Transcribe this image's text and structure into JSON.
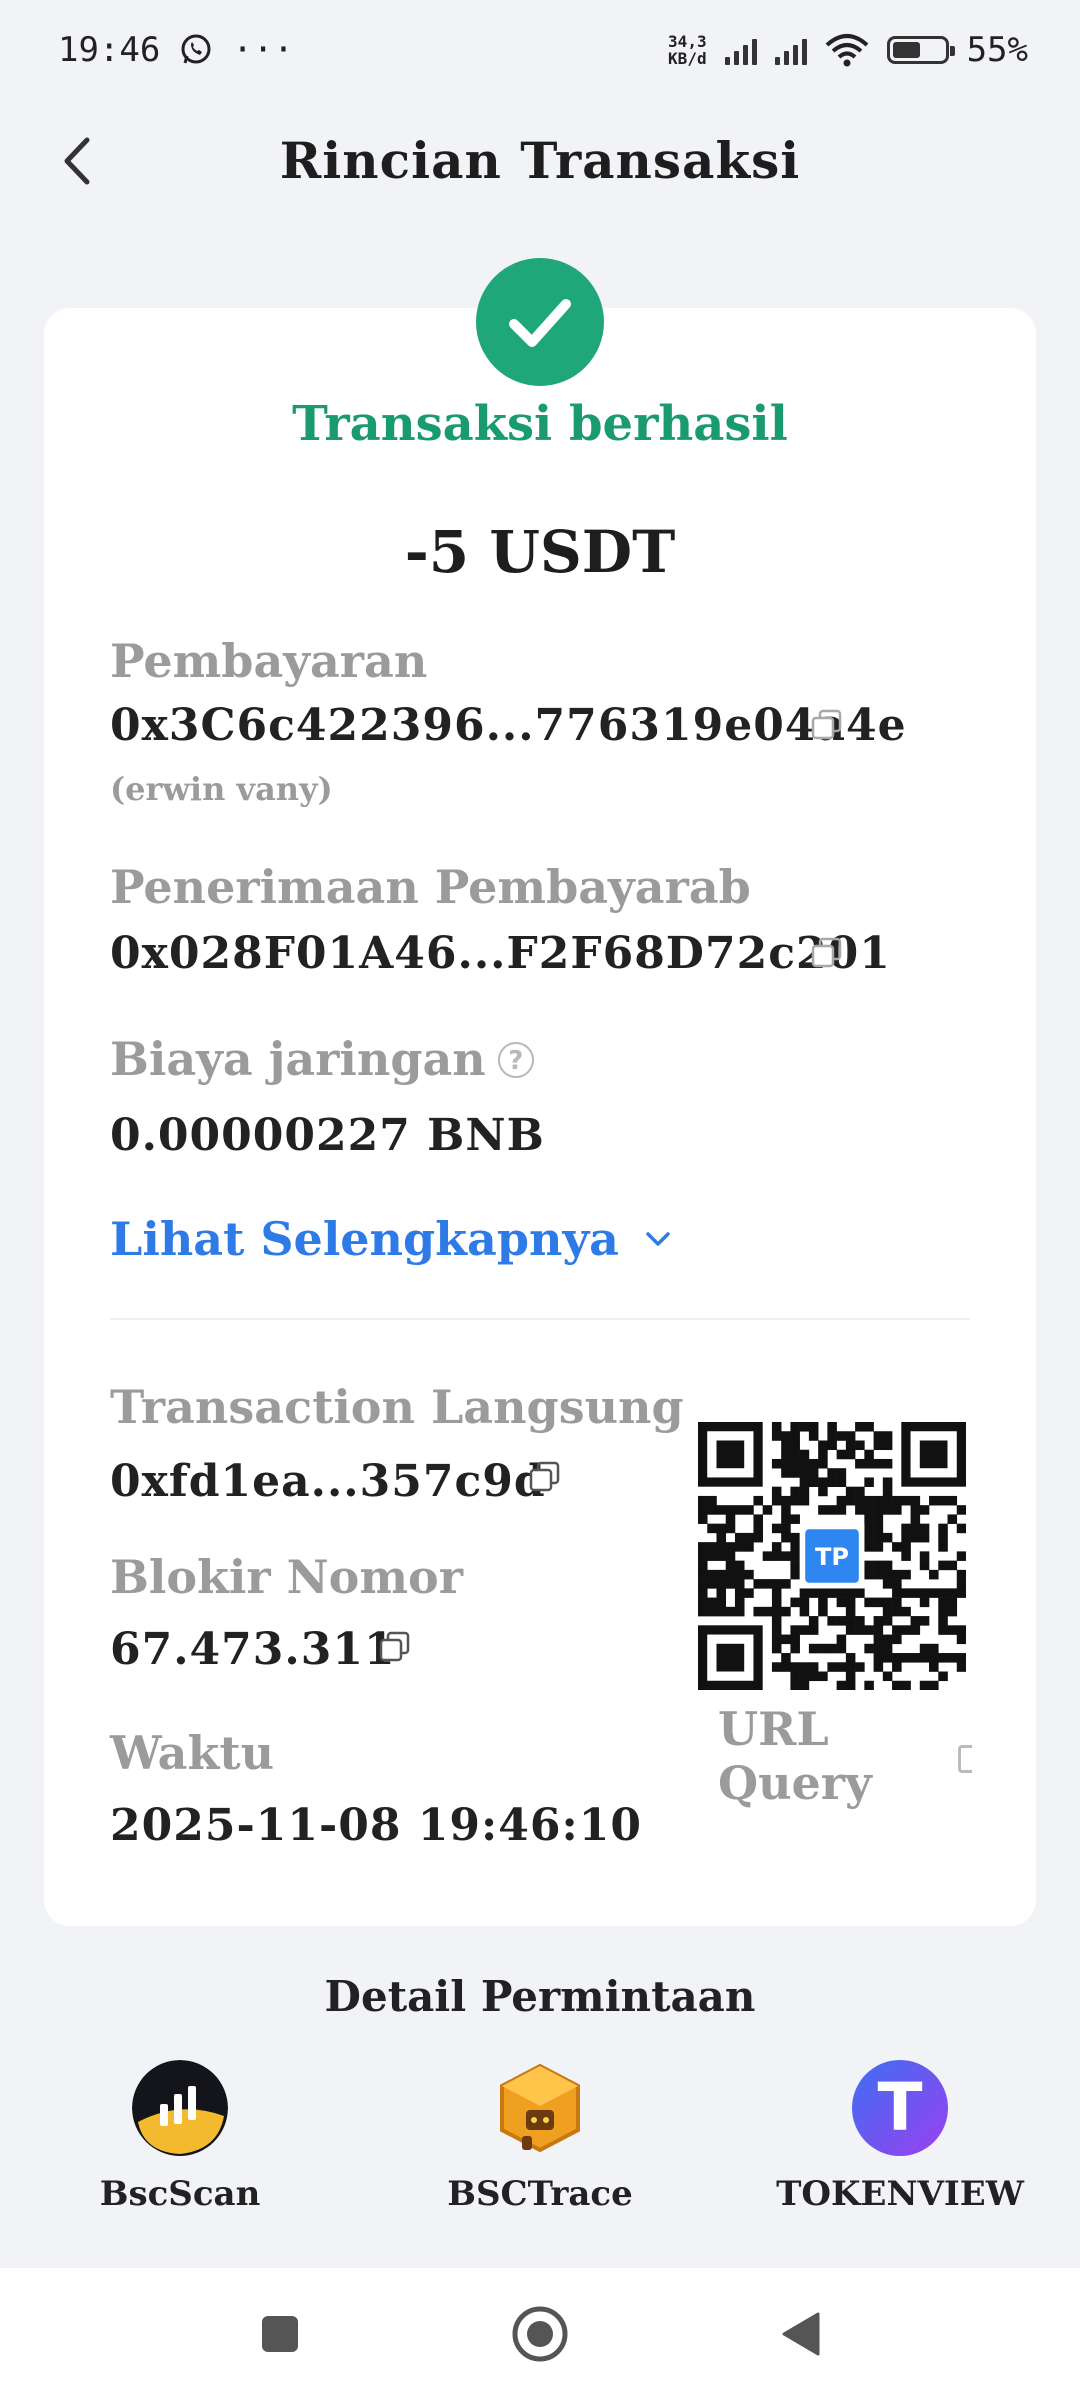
{
  "status_bar": {
    "time": "19:46",
    "more": "···",
    "net_speed_value": "34,3",
    "net_speed_unit": "KB/d",
    "battery_level": 55,
    "battery_text": "55%"
  },
  "header": {
    "title": "Rincian Transaksi"
  },
  "transaction": {
    "status": "Transaksi berhasil",
    "amount": "-5 USDT",
    "payment_label": "Pembayaran",
    "payment_address": "0x3C6c422396...776319e04a4e",
    "payment_name": "(erwin vany)",
    "receiver_label": "Penerimaan Pembayarab",
    "receiver_address": "0x028F01A46...F2F68D72c201",
    "fee_label": "Biaya jaringan",
    "fee_help": "?",
    "fee_value": "0.00000227 BNB",
    "more_label": "Lihat Selengkapnya",
    "tx_label": "Transaction Langsung",
    "tx_hash": "0xfd1ea...357c9d",
    "block_label": "Blokir Nomor",
    "block_number": "67.473.311",
    "time_label": "Waktu",
    "time_value": "2025-11-08 19:46:10",
    "qr_badge": "TP",
    "qr_label_line1": "URL",
    "qr_label_line2": "Query"
  },
  "explorers": {
    "title": "Detail Permintaan",
    "items": [
      {
        "name": "BscScan",
        "icon": "bscscan-icon"
      },
      {
        "name": "BSCTrace",
        "icon": "bsctrace-icon"
      },
      {
        "name": "TOKENVIEW",
        "icon": "tokenview-icon",
        "glyph": "T"
      }
    ]
  },
  "colors": {
    "success": "#1fa77a",
    "link": "#2e7be8",
    "background": "#f2f3f7"
  }
}
